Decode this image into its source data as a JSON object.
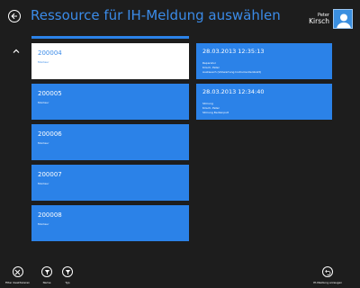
{
  "header": {
    "title": "Ressource für IH-Meldung auswählen",
    "user_first": "Peter",
    "user_last": "Kirsch"
  },
  "resources": [
    {
      "number": "200004",
      "label": "Monteur",
      "selected": true
    },
    {
      "number": "200005",
      "label": "Monteur",
      "selected": false
    },
    {
      "number": "200006",
      "label": "Monteur",
      "selected": false
    },
    {
      "number": "200007",
      "label": "Monteur",
      "selected": false
    },
    {
      "number": "200008",
      "label": "Monteur",
      "selected": false
    }
  ],
  "entries": [
    {
      "date": "28.03.2013 12:35:13",
      "lines": [
        "Reparatur",
        "Kirsch, Peter",
        "Austausch (Vollwartung Instrumentenbrett)"
      ]
    },
    {
      "date": "28.03.2013 12:34:40",
      "lines": [
        "Störung",
        "Kirsch, Peter",
        "Störung Bedienpult"
      ]
    }
  ],
  "appbar": {
    "filter_off": "Filter deaktivieren",
    "name": "Name",
    "type": "Typ",
    "create": "IH-Meldung erzeugen"
  },
  "colors": {
    "accent": "#2b82e8",
    "background": "#1d1d1d"
  }
}
